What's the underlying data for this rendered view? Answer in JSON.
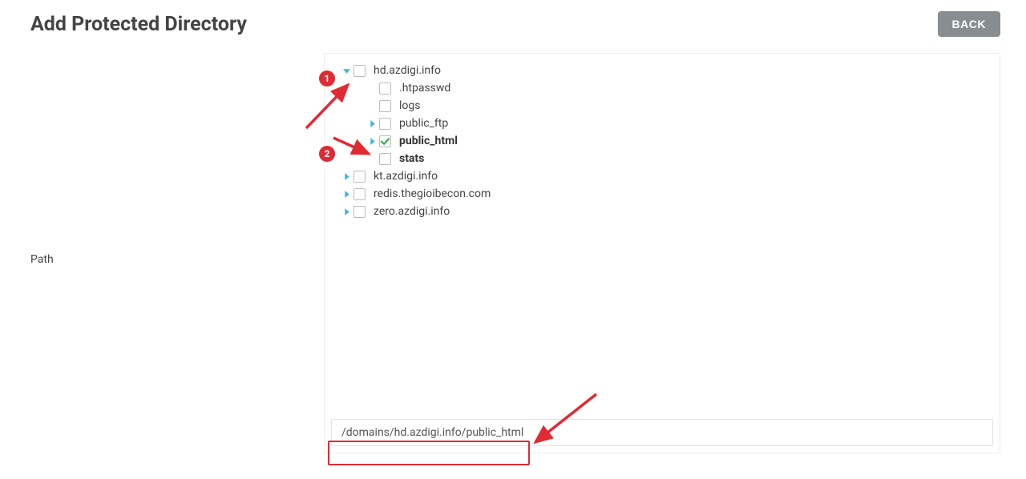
{
  "header": {
    "title": "Add Protected Directory",
    "back_label": "BACK"
  },
  "side": {
    "path_label": "Path"
  },
  "tree": {
    "nodes": [
      {
        "label": "hd.azdigi.info",
        "indent": 0,
        "expanded": true,
        "hasToggle": true,
        "checked": false,
        "bold": false
      },
      {
        "label": ".htpasswd",
        "indent": 1,
        "expanded": false,
        "hasToggle": false,
        "checked": false,
        "bold": false
      },
      {
        "label": "logs",
        "indent": 1,
        "expanded": false,
        "hasToggle": false,
        "checked": false,
        "bold": false
      },
      {
        "label": "public_ftp",
        "indent": 1,
        "expanded": false,
        "hasToggle": true,
        "checked": false,
        "bold": false
      },
      {
        "label": "public_html",
        "indent": 1,
        "expanded": false,
        "hasToggle": true,
        "checked": true,
        "bold": true
      },
      {
        "label": "stats",
        "indent": 1,
        "expanded": false,
        "hasToggle": false,
        "checked": false,
        "bold": true
      },
      {
        "label": "kt.azdigi.info",
        "indent": 0,
        "expanded": false,
        "hasToggle": true,
        "checked": false,
        "bold": false
      },
      {
        "label": "redis.thegioibecon.com",
        "indent": 0,
        "expanded": false,
        "hasToggle": true,
        "checked": false,
        "bold": false
      },
      {
        "label": "zero.azdigi.info",
        "indent": 0,
        "expanded": false,
        "hasToggle": true,
        "checked": false,
        "bold": false
      }
    ]
  },
  "path": {
    "value": "/domains/hd.azdigi.info/public_html"
  },
  "annotations": {
    "badge1": "1",
    "badge2": "2"
  },
  "colors": {
    "accent": "#3cb6e3",
    "check": "#2fa84f",
    "annotation": "#e02b34"
  }
}
